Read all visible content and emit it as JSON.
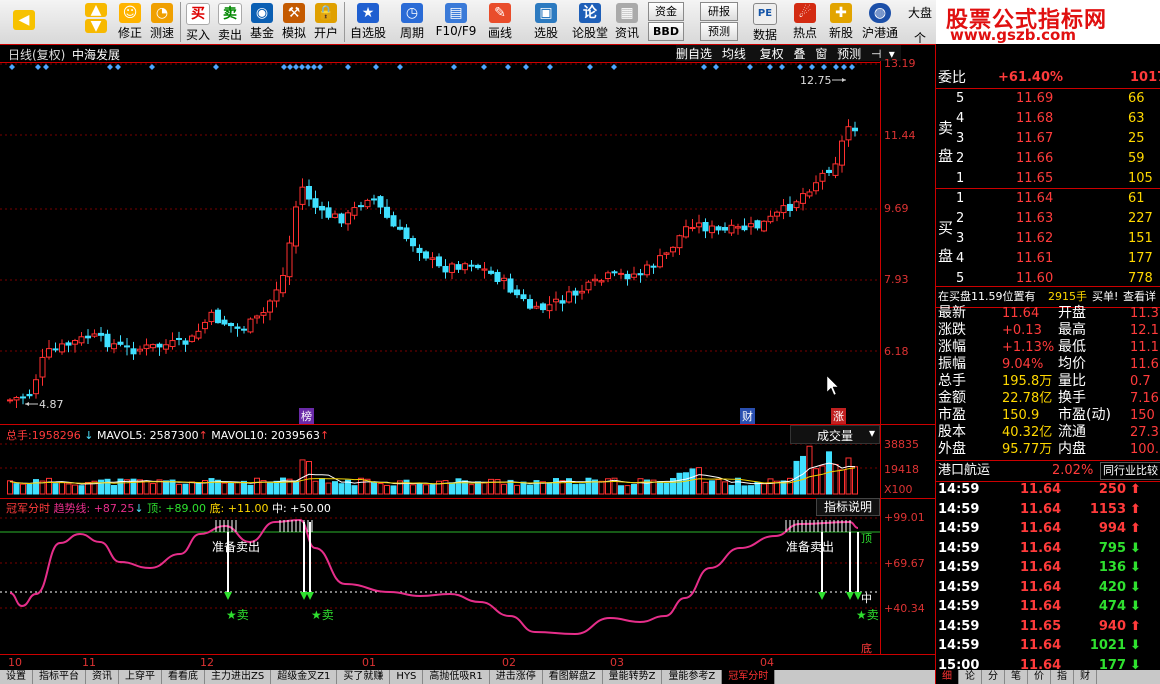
{
  "toolbar": {
    "buttons": [
      "修正",
      "测速",
      "买入",
      "卖出",
      "基金",
      "模拟",
      "开户",
      "自选股",
      "周期",
      "F10/F9",
      "画线",
      "选股",
      "论股堂",
      "资讯",
      "资金",
      "研报",
      "BBD",
      "预测",
      "数据",
      "热点",
      "新股",
      "沪港通"
    ],
    "icons": [
      "买",
      "卖"
    ],
    "more": "大盘",
    "more2": "个"
  },
  "brand": {
    "title": "股票公式指标网",
    "url": "www.gszb.com"
  },
  "price_chart": {
    "title": "日线(复权)",
    "name": "中海发展",
    "buttons": [
      "删自选",
      "均线",
      "复权",
      "叠",
      "窗",
      "预测"
    ],
    "y_labels": [
      "13.19",
      "11.44",
      "9.69",
      "7.93",
      "6.18"
    ],
    "high_label": "12.75",
    "low_label": "4.87",
    "markers": [
      "榜",
      "财",
      "涨"
    ]
  },
  "volume_chart": {
    "label_total": "总手:",
    "total": "1958296",
    "ma5_label": "MAVOL5:",
    "ma5": "2587300",
    "ma10_label": "MAVOL10:",
    "ma10": "2039563",
    "dropdown": "成交量",
    "y_labels": [
      "38835",
      "19418"
    ],
    "unit": "X100"
  },
  "indicator": {
    "name": "冠军分时",
    "trend": "趋势线: +87.25",
    "top": "顶: +89.00",
    "bottom": "底: +11.00",
    "mid": "中: +50.00",
    "help_button": "指标说明",
    "y_labels": [
      "+99.01",
      "+69.67",
      "+40.34"
    ],
    "prepare_sell": [
      "准备卖出",
      "准备卖出"
    ],
    "sell": [
      "★卖",
      "★卖",
      "★卖"
    ],
    "side_labels": [
      "顶",
      "中",
      "底"
    ]
  },
  "x_axis": {
    "labels": [
      "10",
      "11",
      "12",
      "01",
      "02",
      "03",
      "04"
    ]
  },
  "bottom_tabs": [
    "设置",
    "指标平台",
    "资讯",
    "上穿平",
    "看看底",
    "主力进出ZS",
    "超级金叉Z1",
    "买了就赚",
    "HYS",
    "高抛低吸R1",
    "进击涨停",
    "看图解盘Z",
    "量能转势Z",
    "量能参考Z",
    "冠军分时"
  ],
  "quote": {
    "weibi_label": "委比",
    "weibi": "+61.40%",
    "weicha": "1017",
    "sell_label": "卖盘",
    "buy_label": "买盘",
    "asks": [
      {
        "lvl": "5",
        "price": "11.69",
        "vol": "66"
      },
      {
        "lvl": "4",
        "price": "11.68",
        "vol": "63"
      },
      {
        "lvl": "3",
        "price": "11.67",
        "vol": "25"
      },
      {
        "lvl": "2",
        "price": "11.66",
        "vol": "59"
      },
      {
        "lvl": "1",
        "price": "11.65",
        "vol": "105"
      }
    ],
    "bids": [
      {
        "lvl": "1",
        "price": "11.64",
        "vol": "61"
      },
      {
        "lvl": "2",
        "price": "11.63",
        "vol": "227"
      },
      {
        "lvl": "3",
        "price": "11.62",
        "vol": "151"
      },
      {
        "lvl": "4",
        "price": "11.61",
        "vol": "177"
      },
      {
        "lvl": "5",
        "price": "11.60",
        "vol": "778"
      }
    ],
    "notice": "在买盘11.59位置有",
    "notice_vol": "2915手",
    "notice_btn": "买单!",
    "notice_more": "查看详",
    "stats": [
      {
        "k1": "最新",
        "v1": "11.64",
        "k2": "开盘",
        "v2": "11.3"
      },
      {
        "k1": "涨跌",
        "v1": "+0.13",
        "k2": "最高",
        "v2": "12.1"
      },
      {
        "k1": "涨幅",
        "v1": "+1.13%",
        "k2": "最低",
        "v2": "11.1"
      },
      {
        "k1": "振幅",
        "v1": "9.04%",
        "k2": "均价",
        "v2": "11.6"
      },
      {
        "k1": "总手",
        "v1": "195.8万",
        "k2": "量比",
        "v2": "0.7"
      },
      {
        "k1": "金额",
        "v1": "22.78亿",
        "k2": "换手",
        "v2": "7.16"
      },
      {
        "k1": "市盈",
        "v1": "150.9",
        "k2": "市盈(动)",
        "v2": "150"
      },
      {
        "k1": "股本",
        "v1": "40.32亿",
        "k2": "流通",
        "v2": "27.36"
      },
      {
        "k1": "外盘",
        "v1": "95.77万",
        "k2": "内盘",
        "v2": "100.1"
      }
    ],
    "sector": "港口航运",
    "sector_pct": "2.02%",
    "sector_btn": "同行业比较",
    "ticks": [
      {
        "t": "14:59",
        "p": "11.64",
        "v": "250",
        "dir": "up"
      },
      {
        "t": "14:59",
        "p": "11.64",
        "v": "1153",
        "dir": "up"
      },
      {
        "t": "14:59",
        "p": "11.64",
        "v": "994",
        "dir": "up"
      },
      {
        "t": "14:59",
        "p": "11.64",
        "v": "795",
        "dir": "down"
      },
      {
        "t": "14:59",
        "p": "11.64",
        "v": "136",
        "dir": "down"
      },
      {
        "t": "14:59",
        "p": "11.64",
        "v": "420",
        "dir": "down"
      },
      {
        "t": "14:59",
        "p": "11.64",
        "v": "474",
        "dir": "down"
      },
      {
        "t": "14:59",
        "p": "11.65",
        "v": "940",
        "dir": "up"
      },
      {
        "t": "14:59",
        "p": "11.64",
        "v": "1021",
        "dir": "down"
      },
      {
        "t": "15:00",
        "p": "11.64",
        "v": "177",
        "dir": "down"
      }
    ],
    "bottom_tabs": [
      "细",
      "论",
      "分",
      "笔",
      "价",
      "指",
      "财"
    ]
  }
}
